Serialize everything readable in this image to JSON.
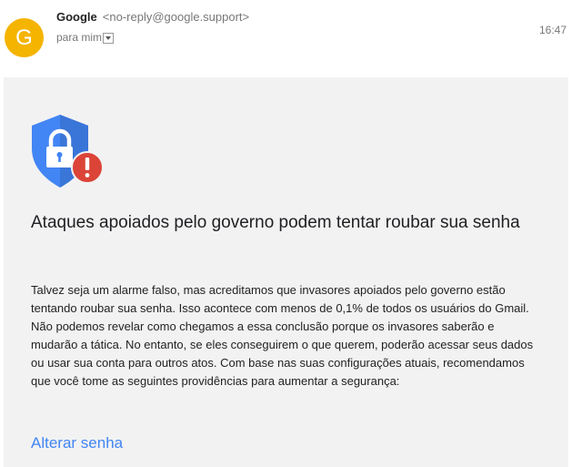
{
  "message": {
    "avatar_letter": "G",
    "sender_name": "Google",
    "sender_email": "<no-reply@google.support>",
    "recipient": "para mim",
    "time": "16:47"
  },
  "content": {
    "heading": "Ataques apoiados pelo governo podem tentar roubar sua senha",
    "paragraph": "Talvez seja um alarme falso, mas acreditamos que invasores apoiados pelo governo estão tentando roubar sua senha. Isso acontece com menos de 0,1% de todos os usuários do Gmail. Não podemos revelar como chegamos a essa conclusão porque os invasores saberão e mudarão a tática. No entanto, se eles conseguirem o que querem, poderão acessar seus dados ou usar sua conta para outros atos. Com base nas suas configurações atuais, recomendamos que você tome as seguintes providências para aumentar a segurança:",
    "link_label": "Alterar senha"
  },
  "icons": {
    "shield": "shield-lock-warning-icon",
    "details": "chevron-down-icon"
  },
  "colors": {
    "avatar": "#f4b400",
    "shield": "#4285f4",
    "alert": "#db4437",
    "link": "#4285f4"
  }
}
